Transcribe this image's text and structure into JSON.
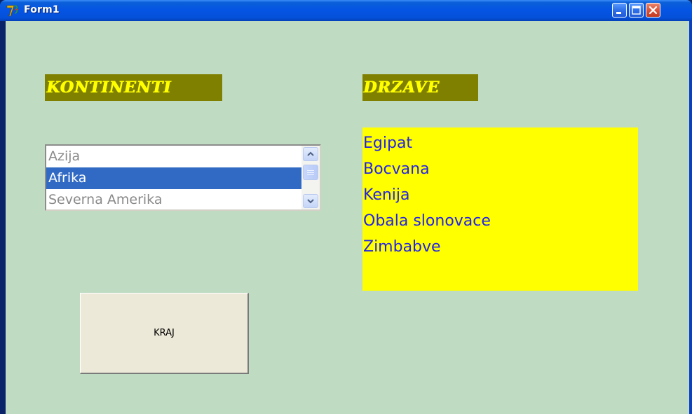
{
  "window": {
    "title": "Form1",
    "controls": {
      "minimize": "minimize-icon",
      "maximize": "maximize-icon",
      "close": "close-icon"
    }
  },
  "form": {
    "background": "#bfdcc3",
    "continents_heading": "KONTINENTI",
    "states_heading": "DRZAVE",
    "heading_colors": {
      "background": "#808000",
      "text": "#ffff00"
    },
    "continents": [
      {
        "label": "Azija",
        "selected": false
      },
      {
        "label": "Afrika",
        "selected": true
      },
      {
        "label": "Severna Amerika",
        "selected": false
      }
    ],
    "states_box_color": "#ffff00",
    "states_text_color": "#2424e6",
    "states": [
      "Egipat",
      "Bocvana",
      "Kenija",
      "Obala slonovace",
      "Zimbabve"
    ],
    "close_button_label": "KRAJ"
  }
}
